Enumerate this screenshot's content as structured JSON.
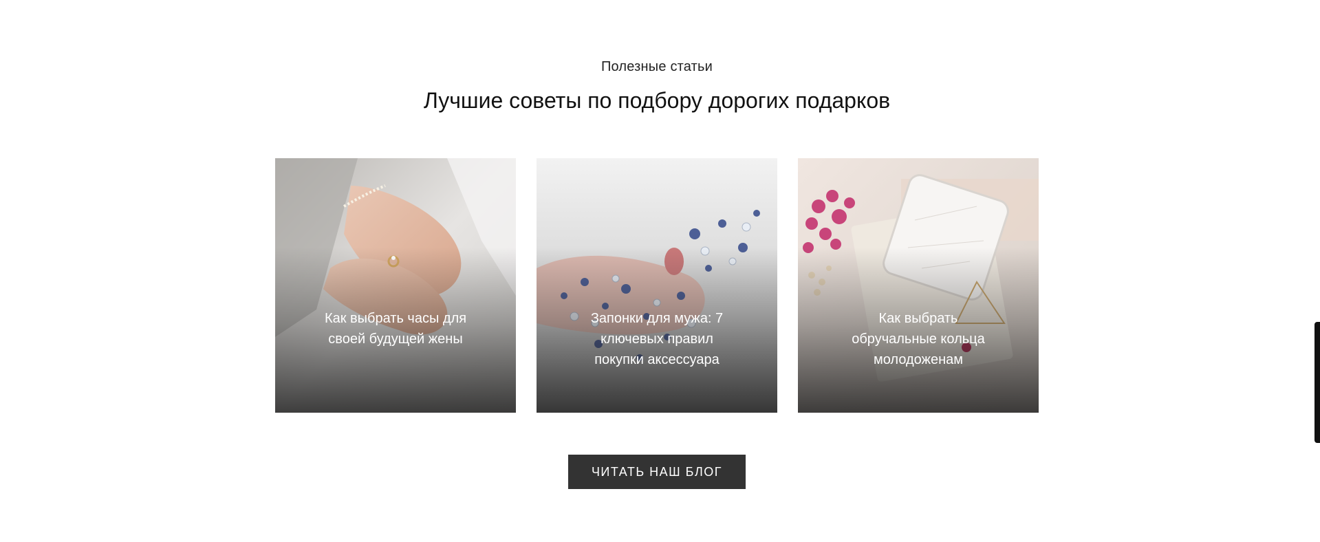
{
  "section": {
    "eyebrow": "Полезные статьи",
    "heading": "Лучшие советы по подбору дорогих подарков"
  },
  "articles": [
    {
      "title": "Как выбрать часы для своей будущей жены",
      "image": "hands-with-ring-and-bracelet-photo"
    },
    {
      "title": "Запонки для мужа: 7 ключевых правил покупки аксессуара",
      "image": "crystal-tiara-in-hand-photo"
    },
    {
      "title": "Как выбрать обручальные кольца молодоженам",
      "image": "phone-flowers-and-earrings-photo"
    }
  ],
  "cta": {
    "label": "ЧИТАТЬ НАШ БЛОГ"
  },
  "colors": {
    "button_bg": "#333333",
    "button_text": "#ffffff",
    "text": "#111111"
  }
}
